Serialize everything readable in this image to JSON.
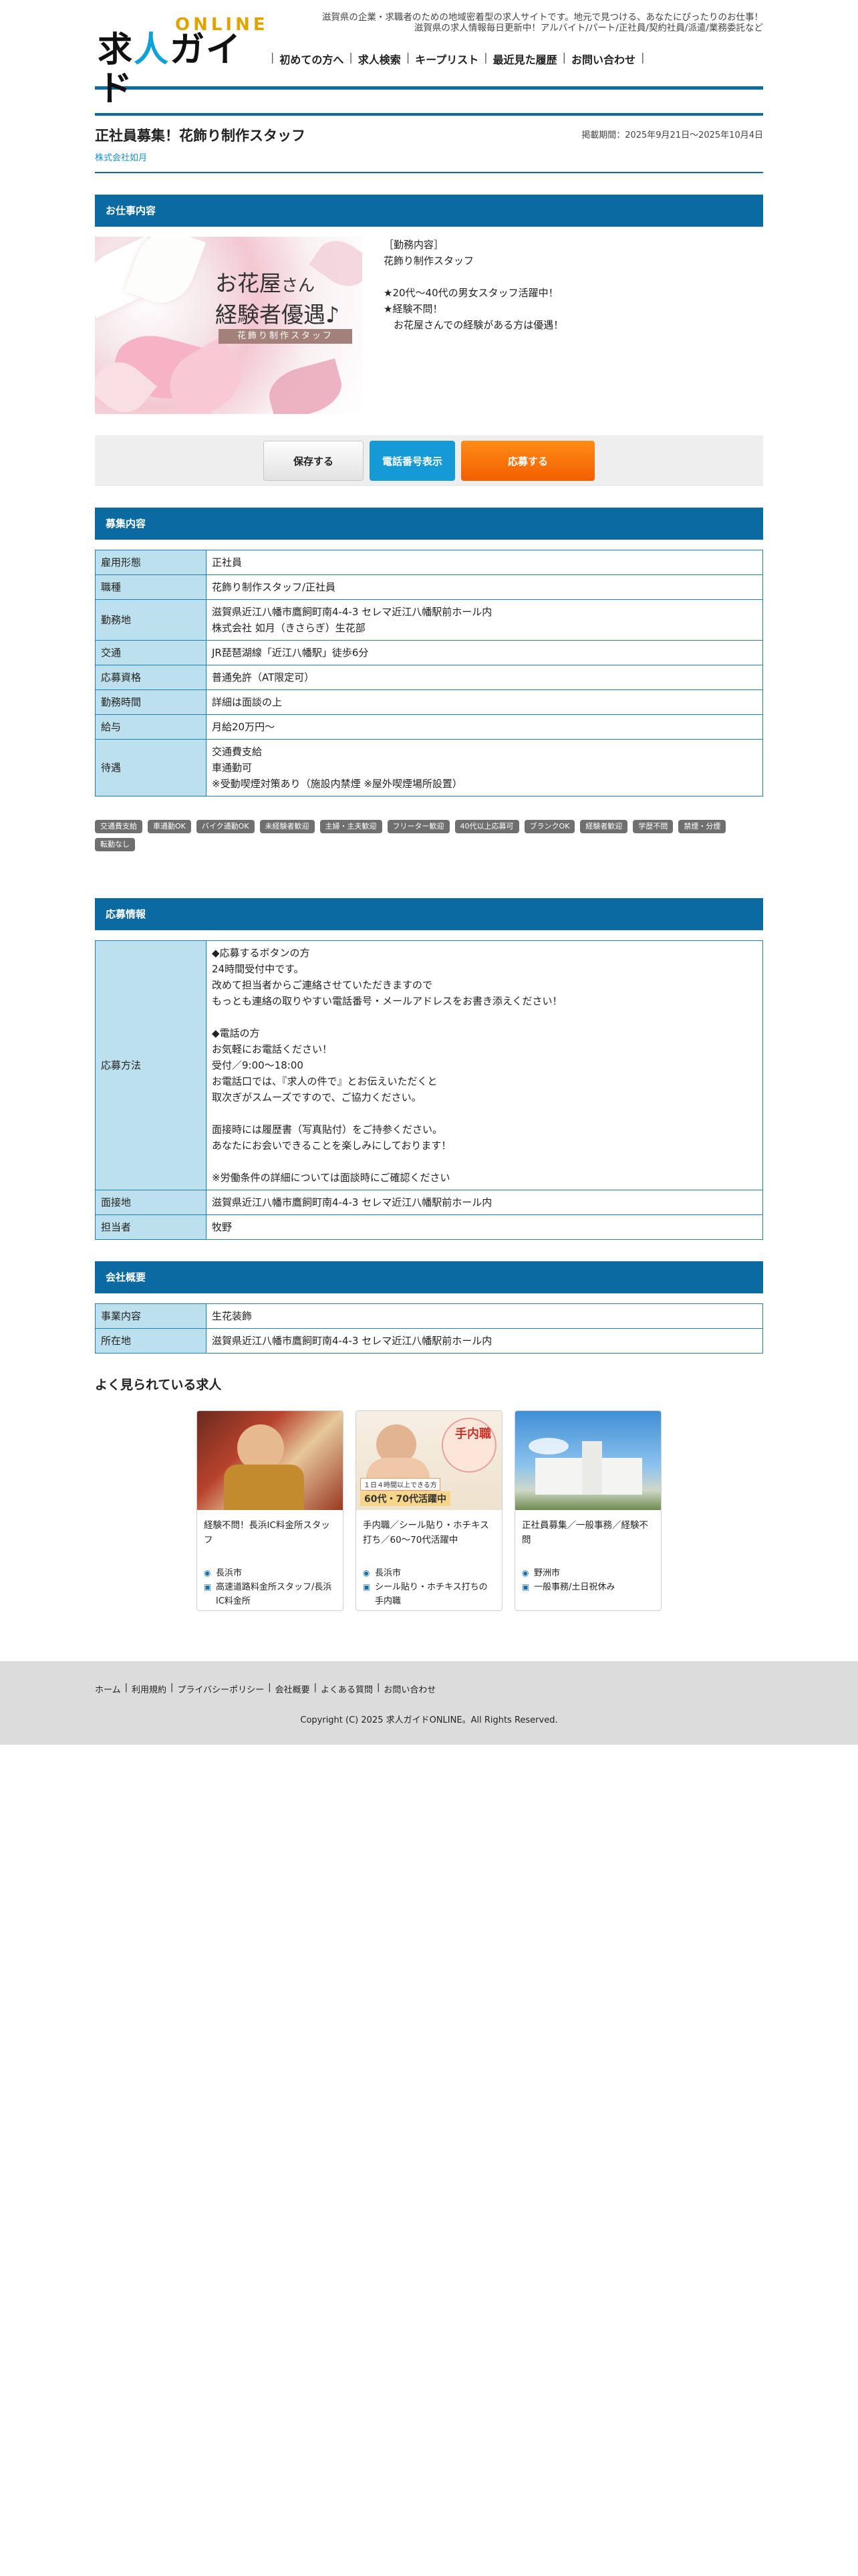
{
  "header": {
    "tagline1": "滋賀県の企業・求職者のための地域密着型の求人サイトです。地元で見つける、あなたにぴったりのお仕事！",
    "tagline2": "滋賀県の求人情報毎日更新中！アルバイト/パート/正社員/契約社員/派遣/業務委託など",
    "logo_online": "ONLINE",
    "logo_main_1": "求",
    "logo_main_2": "人",
    "logo_main_3": "ガイド",
    "nav": [
      "初めての方へ",
      "求人検索",
      "キープリスト",
      "最近見た履歴",
      "お問い合わせ"
    ]
  },
  "job": {
    "title": "正社員募集！花飾り制作スタッフ",
    "period": "掲載期間：2025年9月21日〜2025年10月4日",
    "company": "株式会社如月"
  },
  "job_content": {
    "heading": "お仕事内容",
    "image_title_1": "お花屋",
    "image_title_small": "さん",
    "image_title_2": "経験者優遇♪",
    "image_sub": "花飾り制作スタッフ",
    "text": "［勤務内容］\n花飾り制作スタッフ\n\n★20代〜40代の男女スタッフ活躍中！\n★経験不問！\n　お花屋さんでの経験がある方は優遇！"
  },
  "buttons": {
    "save": "保存する",
    "tel": "電話番号表示",
    "apply": "応募する"
  },
  "recruit": {
    "heading": "募集内容",
    "rows": [
      {
        "label": "雇用形態",
        "value": "正社員"
      },
      {
        "label": "職種",
        "value": "花飾り制作スタッフ/正社員"
      },
      {
        "label": "勤務地",
        "value": "滋賀県近江八幡市鷹飼町南4-4-3 セレマ近江八幡駅前ホール内\n株式会社 如月（きさらぎ）生花部"
      },
      {
        "label": "交通",
        "value": "JR琵琶湖線「近江八幡駅」徒歩6分"
      },
      {
        "label": "応募資格",
        "value": "普通免許（AT限定可）"
      },
      {
        "label": "勤務時間",
        "value": "詳細は面談の上"
      },
      {
        "label": "給与",
        "value": "月給20万円〜"
      },
      {
        "label": "待遇",
        "value": "交通費支給\n車通勤可\n※受動喫煙対策あり（施設内禁煙 ※屋外喫煙場所設置）"
      }
    ]
  },
  "tags": [
    "交通費支給",
    "車通勤OK",
    "バイク通勤OK",
    "未経験者歓迎",
    "主婦・主夫歓迎",
    "フリーター歓迎",
    "40代以上応募可",
    "ブランクOK",
    "経験者歓迎",
    "学歴不問",
    "禁煙・分煙",
    "転勤なし"
  ],
  "apply_info": {
    "heading": "応募情報",
    "rows": [
      {
        "label": "応募方法",
        "value": "◆応募するボタンの方\n24時間受付中です。\n改めて担当者からご連絡させていただきますので\nもっとも連絡の取りやすい電話番号・メールアドレスをお書き添えください！\n\n◆電話の方\nお気軽にお電話ください！\n受付／9:00〜18:00\nお電話口では、『求人の件で』とお伝えいただくと\n取次ぎがスムーズですので、ご協力ください。\n\n面接時には履歴書（写真貼付）をご持参ください。\nあなたにお会いできることを楽しみにしております！\n\n※労働条件の詳細については面談時にご確認ください"
      },
      {
        "label": "面接地",
        "value": "滋賀県近江八幡市鷹飼町南4-4-3 セレマ近江八幡駅前ホール内"
      },
      {
        "label": "担当者",
        "value": "牧野"
      }
    ]
  },
  "company_info": {
    "heading": "会社概要",
    "rows": [
      {
        "label": "事業内容",
        "value": "生花装飾"
      },
      {
        "label": "所在地",
        "value": "滋賀県近江八幡市鷹飼町南4-4-3 セレマ近江八幡駅前ホール内"
      }
    ]
  },
  "popular": {
    "heading": "よく見られている求人",
    "cards": [
      {
        "title": "経験不問！長浜IC料金所スタッフ",
        "location": "長浜市",
        "job": "高速道路料金所スタッフ/長浜IC料金所"
      },
      {
        "title": "手内職／シール貼り・ホチキス打ち／60〜70代活躍中",
        "location": "長浜市",
        "job": "シール貼り・ホチキス打ちの手内職",
        "thumb_badge": "手内職",
        "thumb_caption1": "１日４時間以上できる方",
        "thumb_caption2": "60代・70代活躍中"
      },
      {
        "title": "正社員募集／一般事務／経験不問",
        "location": "野洲市",
        "job": "一般事務/土日祝休み"
      }
    ]
  },
  "footer": {
    "links": [
      "ホーム",
      "利用規約",
      "プライバシーポリシー",
      "会社概要",
      "よくある質問",
      "お問い合わせ"
    ],
    "copyright": "Copyright (C) 2025 求人ガイドONLINE。All Rights Reserved."
  },
  "colors": {
    "primary": "#0a6aa1",
    "table_label_bg": "#bde0ee",
    "apply_button": "#f57200",
    "tel_button": "#169ad6"
  }
}
